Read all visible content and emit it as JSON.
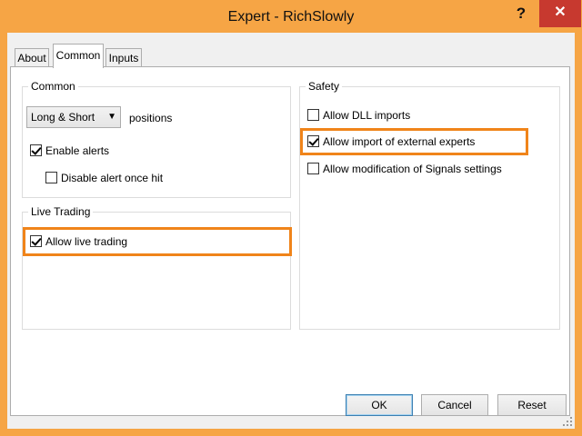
{
  "window": {
    "title": "Expert - RichSlowly",
    "help_label": "?",
    "close_label": "✕"
  },
  "tabs": [
    {
      "label": "About",
      "active": false
    },
    {
      "label": "Common",
      "active": true
    },
    {
      "label": "Inputs",
      "active": false
    }
  ],
  "common_group": {
    "title": "Common",
    "positions_select": {
      "value": "Long & Short",
      "suffix_label": "positions"
    },
    "enable_alerts": {
      "label": "Enable alerts",
      "checked": true
    },
    "disable_alert_once_hit": {
      "label": "Disable alert once hit",
      "checked": false
    }
  },
  "live_trading_group": {
    "title": "Live Trading",
    "allow_live_trading": {
      "label": "Allow live trading",
      "checked": true
    }
  },
  "safety_group": {
    "title": "Safety",
    "allow_dll_imports": {
      "label": "Allow DLL imports",
      "checked": false
    },
    "allow_import_external": {
      "label": "Allow import of external experts",
      "checked": true
    },
    "allow_modification_signals": {
      "label": "Allow modification of Signals settings",
      "checked": false
    }
  },
  "buttons": {
    "ok": "OK",
    "cancel": "Cancel",
    "reset": "Reset"
  },
  "colors": {
    "titlebar": "#f6a545",
    "close": "#c7392f",
    "highlight": "#f0841a"
  }
}
